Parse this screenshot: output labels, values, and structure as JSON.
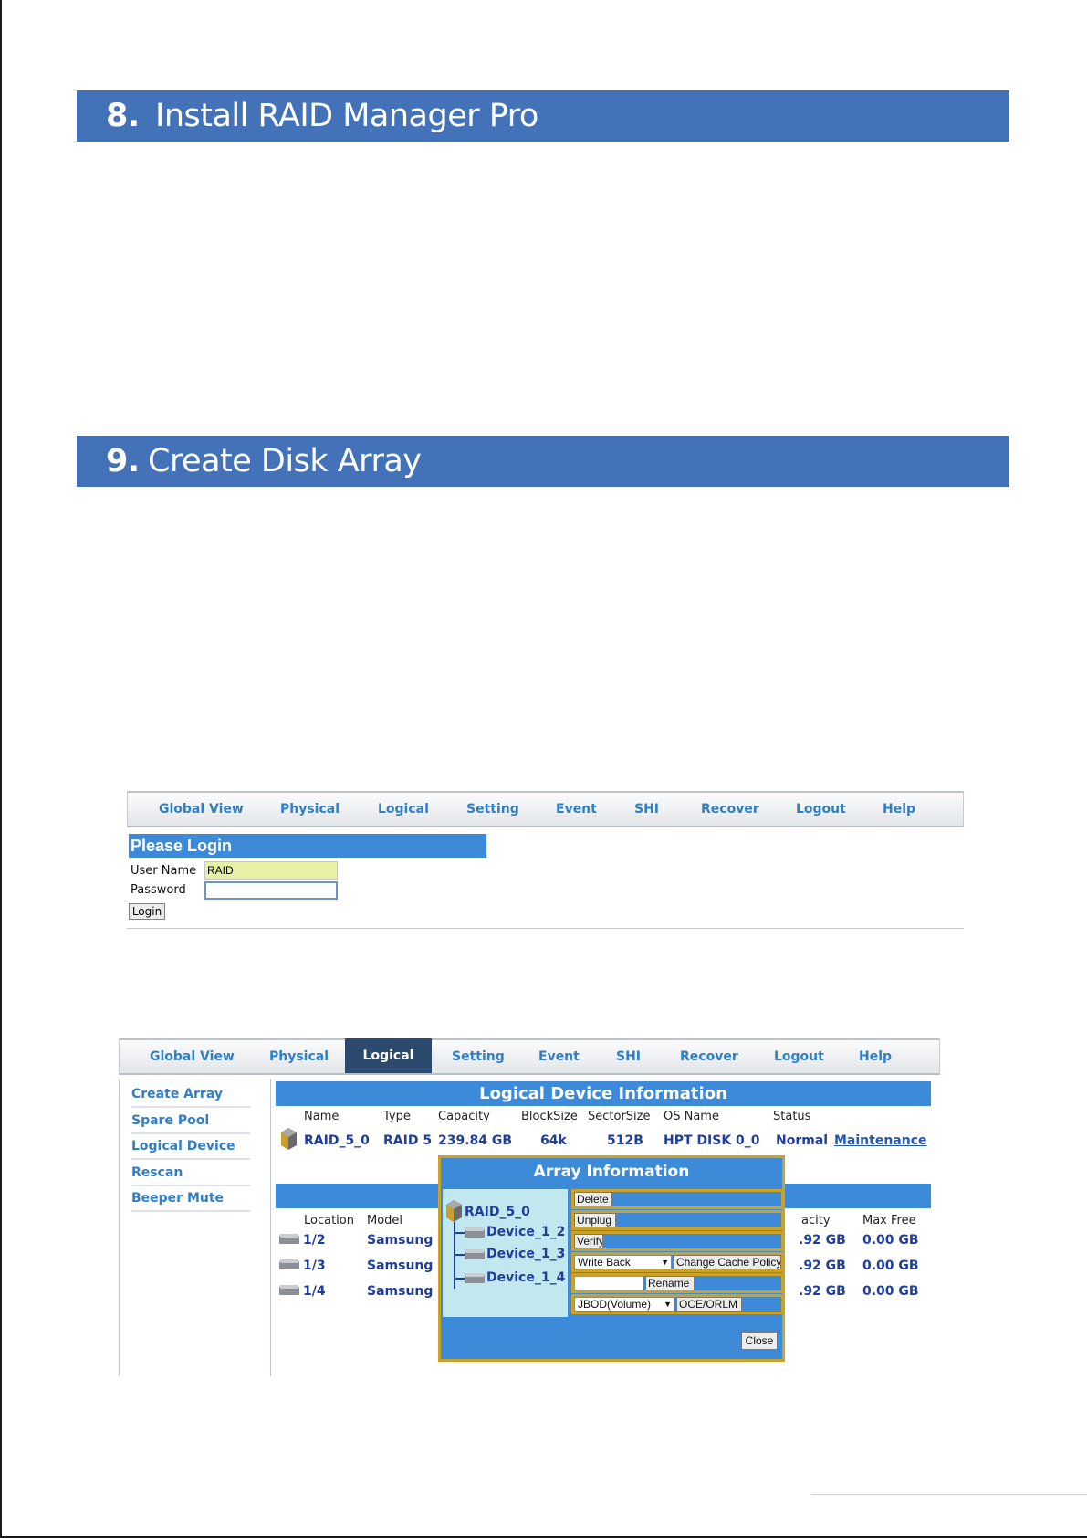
{
  "sections": [
    {
      "number": "8.",
      "title": "Install RAID Manager Pro"
    },
    {
      "number": "9.",
      "title": "Create Disk Array"
    }
  ],
  "colors": {
    "banner": "#4472b9",
    "accent_blue": "#3d8ad8",
    "nav_active": "#2b4a6e",
    "popup_border": "#c9a227"
  },
  "login_screen": {
    "nav": [
      "Global View",
      "Physical",
      "Logical",
      "Setting",
      "Event",
      "SHI",
      "Recover",
      "Logout",
      "Help"
    ],
    "header": "Please Login",
    "username_label": "User Name",
    "username_value": "RAID",
    "password_label": "Password",
    "login_button": "Login"
  },
  "logical_screen": {
    "nav": [
      "Global View",
      "Physical",
      "Logical",
      "Setting",
      "Event",
      "SHI",
      "Recover",
      "Logout",
      "Help"
    ],
    "active_tab": "Logical",
    "sidebar": [
      "Create Array",
      "Spare Pool",
      "Logical Device",
      "Rescan",
      "Beeper Mute"
    ],
    "info_header": "Logical Device Information",
    "array_columns": [
      "Name",
      "Type",
      "Capacity",
      "BlockSize",
      "SectorSize",
      "OS Name",
      "Status"
    ],
    "array_row": {
      "name": "RAID_5_0",
      "type": "RAID 5",
      "capacity": "239.84 GB",
      "block_size": "64k",
      "sector_size": "512B",
      "os_name": "HPT DISK 0_0",
      "status": "Normal",
      "action": "Maintenance"
    },
    "device_columns": [
      "Location",
      "Model",
      "acity",
      "Max Free"
    ],
    "devices": [
      {
        "location": "1/2",
        "model": "Samsung S",
        "capacity": ".92 GB",
        "max_free": "0.00 GB"
      },
      {
        "location": "1/3",
        "model": "Samsung S",
        "capacity": ".92 GB",
        "max_free": "0.00 GB"
      },
      {
        "location": "1/4",
        "model": "Samsung S",
        "capacity": ".92 GB",
        "max_free": "0.00 GB"
      }
    ],
    "popup": {
      "title": "Array Information",
      "root": "RAID_5_0",
      "members": [
        "Device_1_2",
        "Device_1_3",
        "Device_1_4"
      ],
      "delete": "Delete",
      "unplug": "Unplug",
      "verify": "Verify",
      "cache_policy_value": "Write Back",
      "change_cache_policy": "Change Cache Policy",
      "rename": "Rename",
      "migrate_type_value": "JBOD(Volume)",
      "oce": "OCE/ORLM",
      "close": "Close"
    }
  }
}
